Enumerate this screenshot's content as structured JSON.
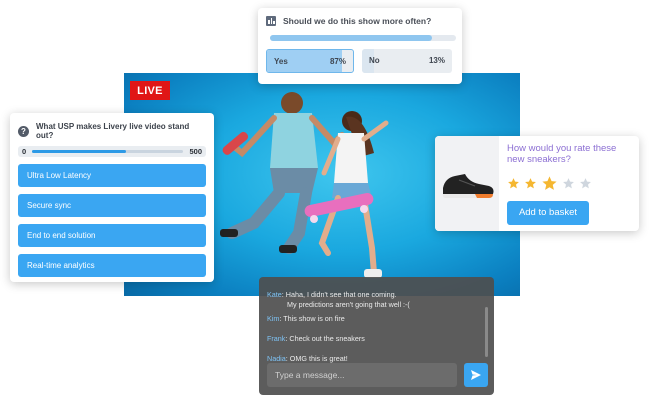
{
  "video": {
    "live_label": "LIVE"
  },
  "top_poll": {
    "question": "Should we do this show more often?",
    "icon": "bar-chart-icon",
    "options": [
      {
        "label": "Yes",
        "percent_text": "87%",
        "percent": 87
      },
      {
        "label": "No",
        "percent_text": "13%",
        "percent": 13
      }
    ]
  },
  "usp_poll": {
    "question": "What USP makes Livery live video stand out?",
    "icon": "question-icon",
    "slider": {
      "min_label": "0",
      "max_label": "500"
    },
    "options": [
      {
        "label": "Ultra Low Latency"
      },
      {
        "label": "Secure sync"
      },
      {
        "label": "End to end solution"
      },
      {
        "label": "Real-time analytics"
      }
    ]
  },
  "rating_card": {
    "question": "How would you rate these new sneakers?",
    "stars_total": 5,
    "stars_filled": 3,
    "button_label": "Add to basket"
  },
  "chat": {
    "messages": [
      {
        "user": "Kate",
        "text": "Haha, I didn't see that one coming.",
        "text2": "My predictions aren't going that well :-("
      },
      {
        "user": "Kim",
        "text": "This show is on fire"
      },
      {
        "user": "Frank",
        "text": "Check out the sneakers"
      },
      {
        "user": "Nadia",
        "text": "OMG this is great!"
      }
    ],
    "input_placeholder": "Type a message..."
  },
  "colors": {
    "accent": "#3aa6f2",
    "live": "#e01616",
    "rating_question": "#8c6fd3",
    "star_filled": "#f5b731",
    "star_empty": "#cfd6de",
    "chat_user": "#7ec3f5"
  }
}
